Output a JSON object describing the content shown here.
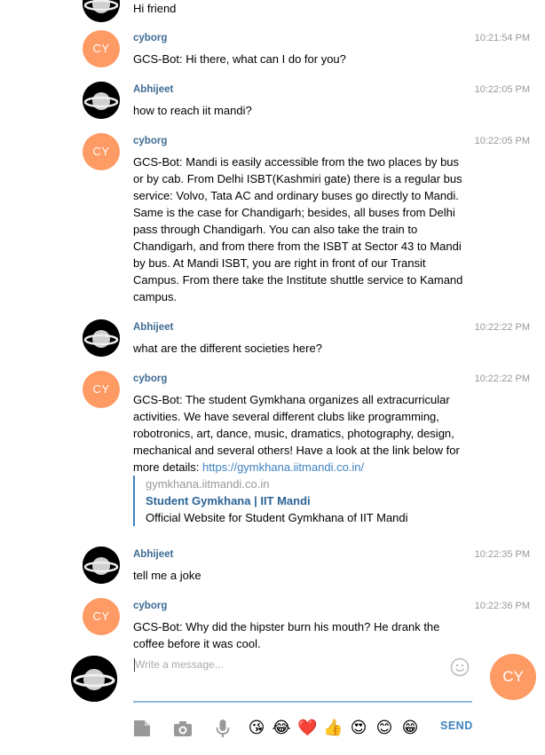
{
  "messages": [
    {
      "author": "",
      "time": "",
      "text": "Hi friend",
      "avatar": "planet"
    },
    {
      "author": "cyborg",
      "time": "10:21:54 PM",
      "text": "GCS-Bot: Hi there, what can I do for you?",
      "avatar": "CY"
    },
    {
      "author": "Abhijeet",
      "time": "10:22:05 PM",
      "text": "how to reach iit mandi?",
      "avatar": "planet"
    },
    {
      "author": "cyborg",
      "time": "10:22:05 PM",
      "text": "GCS-Bot: Mandi is easily accessible from the two places by bus or by cab. From Delhi ISBT(Kashmiri gate) there is a regular bus service: Volvo, Tata AC and ordinary buses go directly to Mandi. Same is the case for Chandigarh; besides, all buses from Delhi pass through Chandigarh. You can also take the train to Chandigarh, and from there from the ISBT at Sector 43 to Mandi by bus. At Mandi ISBT, you are right in front of our Transit Campus. From there take the Institute shuttle service to Kamand campus.",
      "avatar": "CY"
    },
    {
      "author": "Abhijeet",
      "time": "10:22:22 PM",
      "text": "what are the different societies here?",
      "avatar": "planet"
    },
    {
      "author": "cyborg",
      "time": "10:22:22 PM",
      "text": "GCS-Bot: The student Gymkhana organizes all extracurricular activities. We have several different clubs like programming, robotronics, art, dance, music, dramatics, photography, design, mechanical and several others! Have a look at the link below for more details: ",
      "link": "https://gymkhana.iitmandi.co.in/",
      "avatar": "CY"
    },
    {
      "author": "Abhijeet",
      "time": "10:22:35 PM",
      "text": "tell me a joke",
      "avatar": "planet"
    },
    {
      "author": "cyborg",
      "time": "10:22:36 PM",
      "text": "GCS-Bot: Why did the hipster burn his mouth? He drank the coffee before it was cool.",
      "avatar": "CY"
    }
  ],
  "preview": {
    "site": "gymkhana.iitmandi.co.in",
    "title": "Student Gymkhana | IIT Mandi",
    "description": "Official Website for Student Gymkhana of IIT Mandi"
  },
  "avatar_initials": "CY",
  "composer": {
    "placeholder": "Write a message...",
    "send_label": "SEND",
    "peer_initials": "CY",
    "tools": [
      "document-icon",
      "camera-icon",
      "microphone-icon"
    ],
    "emojis": [
      "😘",
      "😂",
      "❤️",
      "👍",
      "😍",
      "😊",
      "😁"
    ]
  },
  "colors": {
    "accent": "#3e82c1",
    "author": "#3e6b93",
    "bot_avatar": "#fe9a63",
    "timestamp": "#999999"
  }
}
